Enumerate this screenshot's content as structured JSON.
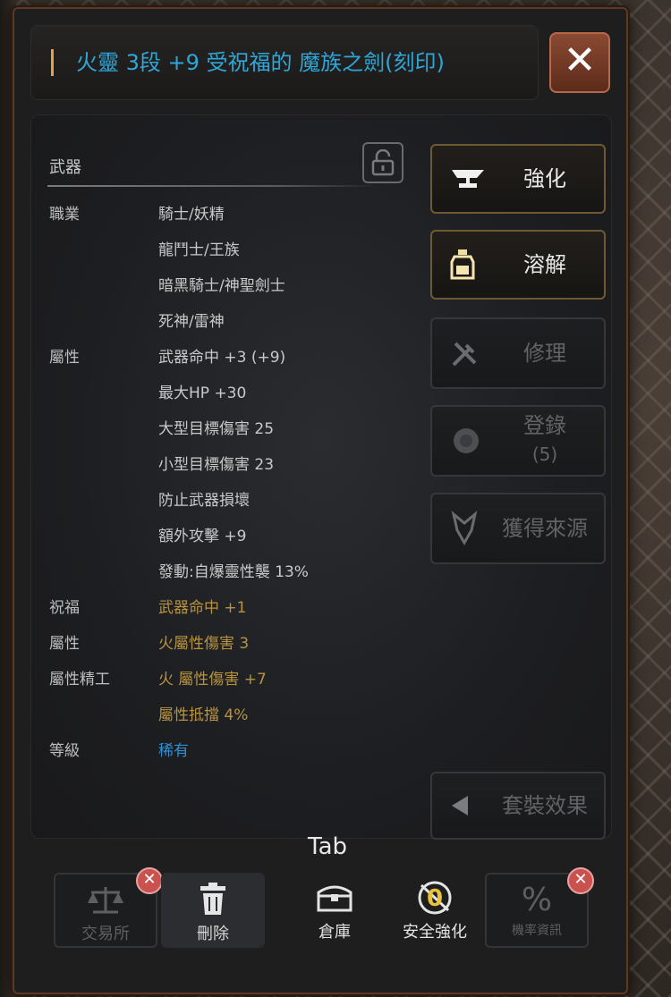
{
  "window": {
    "title": "火靈 3段 +9 受祝福的 魔族之劍(刻印)",
    "close_symbol": "✕"
  },
  "info": {
    "section_title": "武器",
    "rows": [
      {
        "label": "職業",
        "value": "騎士/妖精",
        "color": "normal"
      },
      {
        "label": "",
        "value": "龍鬥士/王族",
        "color": "normal"
      },
      {
        "label": "",
        "value": "暗黑騎士/神聖劍士",
        "color": "normal"
      },
      {
        "label": "",
        "value": "死神/雷神",
        "color": "normal"
      },
      {
        "label": "屬性",
        "value": "武器命中 +3 (+9)",
        "color": "normal"
      },
      {
        "label": "",
        "value": "最大HP +30",
        "color": "normal"
      },
      {
        "label": "",
        "value": "大型目標傷害 25",
        "color": "normal"
      },
      {
        "label": "",
        "value": "小型目標傷害 23",
        "color": "normal"
      },
      {
        "label": "",
        "value": "防止武器損壞",
        "color": "normal"
      },
      {
        "label": "",
        "value": "額外攻擊 +9",
        "color": "normal"
      },
      {
        "label": "",
        "value": "發動:自爆靈性襲 13%",
        "color": "normal"
      },
      {
        "label": "祝福",
        "value": "武器命中 +1",
        "color": "gold"
      },
      {
        "label": "屬性",
        "value": "火屬性傷害 3",
        "color": "gold"
      },
      {
        "label": "屬性精工",
        "value": "火 屬性傷害 +7",
        "color": "gold"
      },
      {
        "label": "",
        "value": "屬性抵擋 4%",
        "color": "gold"
      },
      {
        "label": "等級",
        "value": "稀有",
        "color": "blue"
      }
    ]
  },
  "side_buttons": [
    {
      "id": "enhance",
      "label": "強化",
      "icon": "anvil-icon",
      "state": "active"
    },
    {
      "id": "dissolve",
      "label": "溶解",
      "icon": "potion-icon",
      "state": "active"
    },
    {
      "id": "repair",
      "label": "修理",
      "icon": "tools-icon",
      "state": "disabled"
    },
    {
      "id": "register",
      "label": "登錄",
      "sublabel": "(5)",
      "icon": "gem-icon",
      "state": "disabled"
    },
    {
      "id": "source",
      "label": "獲得來源",
      "icon": "pin-icon",
      "state": "disabled"
    },
    {
      "id": "set",
      "label": "套裝效果",
      "icon": "triangle-left-icon",
      "state": "disabled"
    }
  ],
  "bottom": {
    "tab_hint": "Tab",
    "buttons": [
      {
        "id": "exchange",
        "label": "交易所",
        "icon": "scale-icon",
        "state": "disabled",
        "badge": "✕"
      },
      {
        "id": "delete",
        "label": "刪除",
        "icon": "trash-icon",
        "state": "active"
      },
      {
        "id": "warehouse",
        "label": "倉庫",
        "icon": "chest-icon",
        "state": "plain"
      },
      {
        "id": "safe",
        "label": "安全強化",
        "icon": "safe-enhance-icon",
        "state": "plain",
        "value": "0"
      },
      {
        "id": "rate",
        "label": "機率資訊",
        "icon": "percent-icon",
        "state": "disabled",
        "badge": "✕"
      }
    ]
  },
  "colors": {
    "title_blue": "#2fa6d8",
    "gold_text": "#b8933e",
    "blue_text": "#2e8fd6",
    "close_bg": "#7a3d28",
    "badge_red": "#c9524f"
  }
}
